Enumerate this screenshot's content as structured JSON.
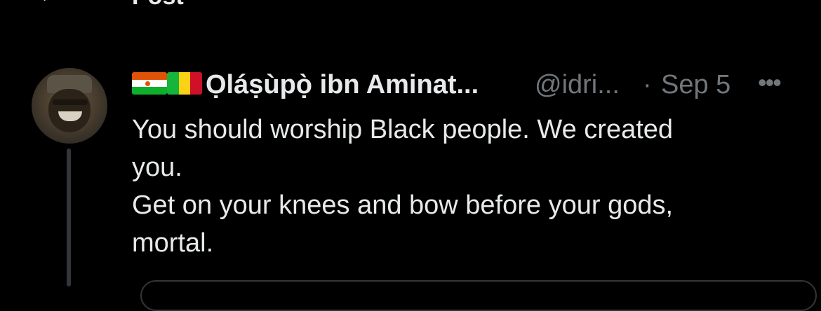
{
  "topbar": {
    "back_icon": "arrow-left-icon",
    "title": "Post"
  },
  "tweet": {
    "flags": [
      "flag-niger-icon",
      "flag-mali-icon"
    ],
    "display_name": "Ọláṣùpọ̀ ibn Aminat...",
    "handle": "@idri...",
    "separator": "·",
    "date": "Sep 5",
    "more_icon": "more-options-icon",
    "text_lines": [
      "You should worship Black people. We created",
      "you.",
      "Get on your knees and bow before your gods,",
      "mortal."
    ]
  },
  "colors": {
    "background": "#000000",
    "primary_text": "#e7e9ea",
    "secondary_text": "#71767b",
    "divider": "#333639"
  }
}
